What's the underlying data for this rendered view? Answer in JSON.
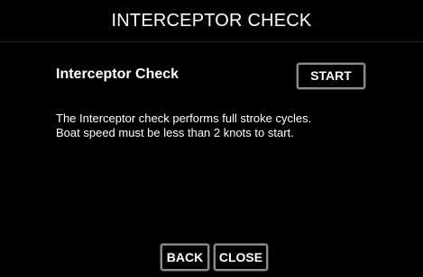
{
  "screen": {
    "title": "INTERCEPTOR CHECK"
  },
  "section": {
    "heading": "Interceptor Check",
    "description": "The Interceptor check performs full stroke cycles. Boat speed must be less than 2 knots to start."
  },
  "buttons": {
    "start_label": "START",
    "back_label": "BACK",
    "close_label": "CLOSE"
  },
  "colors": {
    "background": "#000000",
    "text": "#ffffff",
    "button_border": "#8c8c8c"
  }
}
